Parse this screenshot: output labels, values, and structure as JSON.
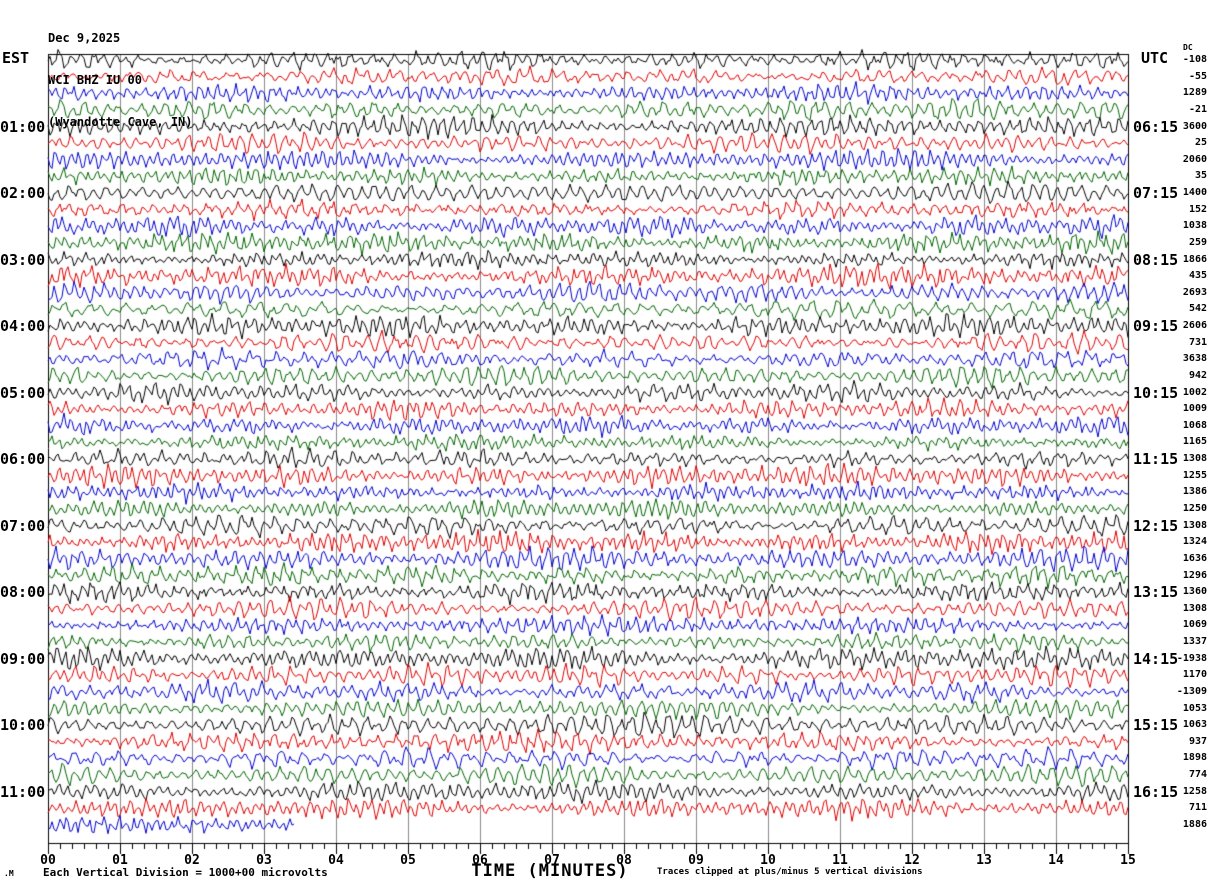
{
  "header": {
    "date": "Dec 9,2025",
    "station": "WCI BHZ IU 00",
    "location": "(Wyandotte Cave, IN)"
  },
  "left_axis": {
    "tz": "EST",
    "hours": [
      "01:00",
      "02:00",
      "03:00",
      "04:00",
      "05:00",
      "06:00",
      "07:00",
      "08:00",
      "09:00",
      "10:00",
      "11:00"
    ]
  },
  "right_axis": {
    "tz": "UTC",
    "hours": [
      "06:15",
      "07:15",
      "08:15",
      "09:15",
      "10:15",
      "11:15",
      "12:15",
      "13:15",
      "14:15",
      "15:15",
      "16:15"
    ]
  },
  "dc_column": {
    "label": "DC",
    "values": [
      -108,
      -55,
      1289,
      -21,
      3600,
      25,
      2060,
      35,
      1400,
      152,
      1038,
      259,
      1866,
      435,
      2693,
      542,
      2606,
      731,
      3638,
      942,
      1002,
      1009,
      1068,
      1165,
      1308,
      1255,
      1386,
      1250,
      1308,
      1324,
      1636,
      1296,
      1360,
      1308,
      1069,
      1337,
      -1938,
      1170,
      -1309,
      1053,
      1063,
      937,
      1898,
      774,
      1258,
      711,
      1886
    ]
  },
  "x_axis": {
    "labels": [
      "00",
      "01",
      "02",
      "03",
      "04",
      "05",
      "06",
      "07",
      "08",
      "09",
      "10",
      "11",
      "12",
      "13",
      "14",
      "15"
    ],
    "title": "TIME (MINUTES)"
  },
  "footer": {
    "mark": ".M",
    "scale_note": "Each Vertical Division = 1000+00 microvolts",
    "clip_note": "Traces clipped at plus/minus 5 vertical divisions"
  },
  "colors": {
    "black": "#000000",
    "red": "#dd0000",
    "blue": "#0000cc",
    "green": "#006600",
    "grid": "#8a8a8a"
  },
  "chart_data": {
    "type": "line",
    "subtype": "helicorder-seismogram",
    "title": "WCI BHZ IU 00 (Wyandotte Cave, IN) Dec 9,2025",
    "xlabel": "TIME (MINUTES)",
    "x_range_minutes": [
      0,
      15
    ],
    "minutes_per_line": 15,
    "traces_per_hour": 4,
    "trace_color_cycle": [
      "#000000",
      "#dd0000",
      "#0000cc",
      "#006600"
    ],
    "grid": "vertical lines at every minute",
    "legend_position": "none",
    "scale_note": "Each Vertical Division = 1000+00 microvolts",
    "clip_note": "Traces clipped at plus/minus 5 vertical divisions",
    "rows": [
      {
        "est_label": "",
        "utc_label": "",
        "dc_offsets": [
          -108,
          -55,
          1289,
          -21
        ]
      },
      {
        "est_label": "01:00",
        "utc_label": "06:15",
        "dc_offsets": [
          3600,
          25,
          2060,
          35
        ]
      },
      {
        "est_label": "02:00",
        "utc_label": "07:15",
        "dc_offsets": [
          1400,
          152,
          1038,
          259
        ]
      },
      {
        "est_label": "03:00",
        "utc_label": "08:15",
        "dc_offsets": [
          1866,
          435,
          2693,
          542
        ]
      },
      {
        "est_label": "04:00",
        "utc_label": "09:15",
        "dc_offsets": [
          2606,
          731,
          3638,
          942
        ]
      },
      {
        "est_label": "05:00",
        "utc_label": "10:15",
        "dc_offsets": [
          1002,
          1009,
          1068,
          1165
        ]
      },
      {
        "est_label": "06:00",
        "utc_label": "11:15",
        "dc_offsets": [
          1308,
          1255,
          1386,
          1250
        ]
      },
      {
        "est_label": "07:00",
        "utc_label": "12:15",
        "dc_offsets": [
          1308,
          1324,
          1636,
          1296
        ]
      },
      {
        "est_label": "08:00",
        "utc_label": "13:15",
        "dc_offsets": [
          1360,
          1308,
          1069,
          1337
        ]
      },
      {
        "est_label": "09:00",
        "utc_label": "14:15",
        "dc_offsets": [
          -1938,
          1170,
          -1309,
          1053
        ]
      },
      {
        "est_label": "10:00",
        "utc_label": "15:15",
        "dc_offsets": [
          1063,
          937,
          1898,
          774
        ]
      },
      {
        "est_label": "11:00",
        "utc_label": "16:15",
        "dc_offsets": [
          1258,
          711,
          1886
        ],
        "partial": true,
        "last_trace_end_minute": 3.4
      }
    ]
  }
}
